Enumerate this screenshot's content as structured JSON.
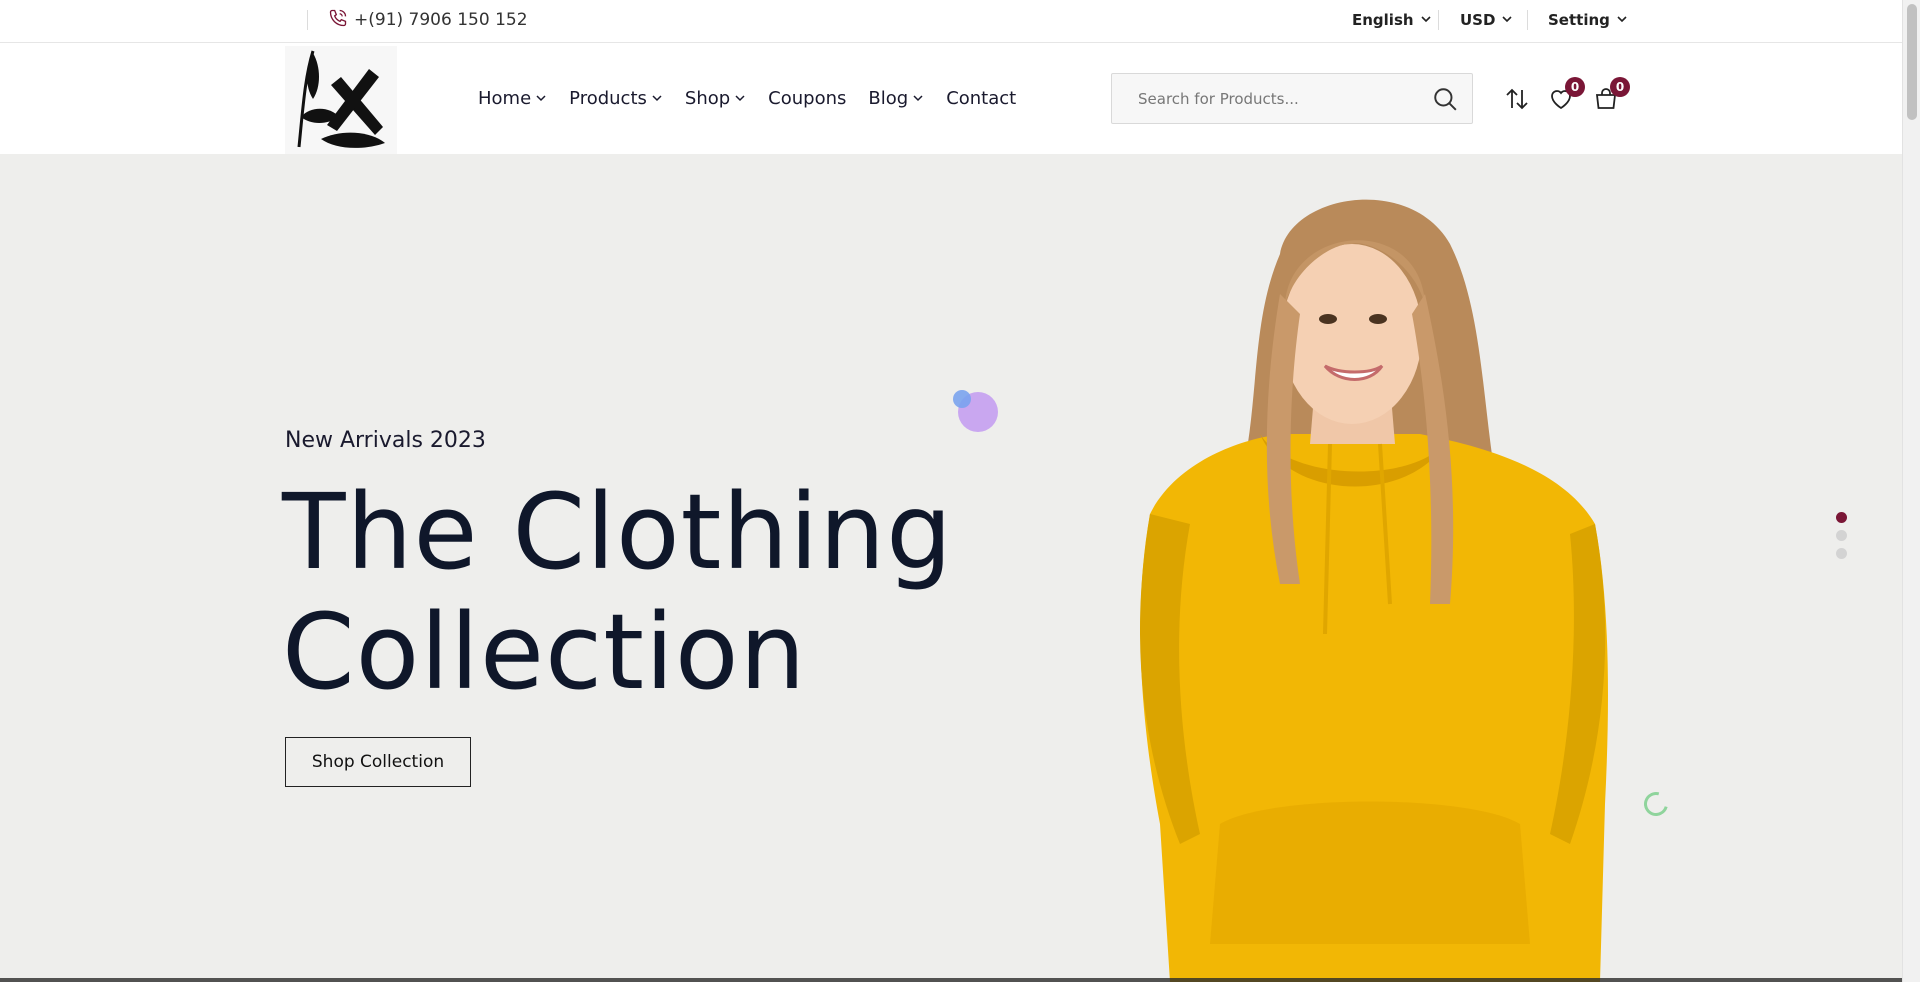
{
  "topbar": {
    "phone": "+(91) 7906 150 152",
    "language": "English",
    "currency": "USD",
    "setting": "Setting"
  },
  "nav": {
    "items": [
      {
        "label": "Home",
        "has_dropdown": true
      },
      {
        "label": "Products",
        "has_dropdown": true
      },
      {
        "label": "Shop",
        "has_dropdown": true
      },
      {
        "label": "Coupons",
        "has_dropdown": false
      },
      {
        "label": "Blog",
        "has_dropdown": true
      },
      {
        "label": "Contact",
        "has_dropdown": false
      }
    ]
  },
  "search": {
    "placeholder": "Search for Products...",
    "value": ""
  },
  "header_icons": {
    "compare": "compare-icon",
    "wishlist": "heart-icon",
    "wishlist_count": "0",
    "cart": "shopping-bag-icon",
    "cart_count": "0"
  },
  "hero": {
    "subtitle": "New Arrivals 2023",
    "title_line1": "The Clothing",
    "title_line2": "Collection",
    "button_label": "Shop Collection",
    "slides": 3,
    "active_slide": 1
  },
  "colors": {
    "accent": "#7a1636",
    "hero_bg": "#eeeeec",
    "hoodie": "#f2b705",
    "text_dark": "#0f172a"
  }
}
